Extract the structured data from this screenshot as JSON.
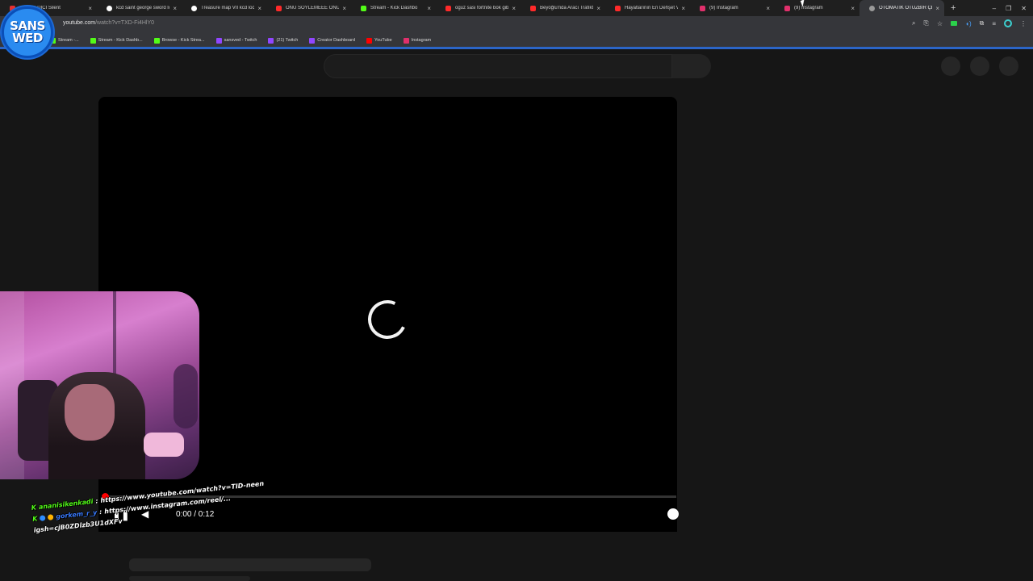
{
  "browser": {
    "tabs": [
      {
        "title": "ATSIZ EDİCİ Silent",
        "favicon_color": "#e63030",
        "active": false
      },
      {
        "title": "kcd saint george sword lo",
        "favicon_color": "#ffffff",
        "active": false
      },
      {
        "title": "Treasure map VII kcd locat",
        "favicon_color": "#ffffff",
        "active": false
      },
      {
        "title": "ONU SÖYLEMEEE ONU",
        "favicon_color": "#ff2a2a",
        "active": false
      },
      {
        "title": "Stream - Kick Dashbo",
        "favicon_color": "#53fc18",
        "active": false
      },
      {
        "title": "oguz sasi fortnite bok gib",
        "favicon_color": "#ff2a2a",
        "active": false
      },
      {
        "title": "Beyoğlu'nda Aracı Trafikte",
        "favicon_color": "#ff2a2a",
        "active": false
      },
      {
        "title": "Hayatlarının En Dehşet Ve",
        "favicon_color": "#ff2a2a",
        "active": false
      },
      {
        "title": "(9) Instagram",
        "favicon_color": "#e1306c",
        "active": false
      },
      {
        "title": "(9) Instagram",
        "favicon_color": "#e1306c",
        "active": false
      },
      {
        "title": "OTOMATİK OTUZBİR ÇEK",
        "favicon_color": "#9a9a9a",
        "active": true
      }
    ],
    "close_glyph": "×",
    "new_tab": "+",
    "window_controls": {
      "minimize": "–",
      "restore": "❐",
      "close": "✕"
    },
    "address": {
      "host": "youtube.com",
      "path": "/watch?v=TXD-Fi4HlY0"
    },
    "bookmarks": [
      {
        "label": "Stream -...",
        "icon_color": "#53fc18"
      },
      {
        "label": "Stream - Kick Dashb...",
        "icon_color": "#53fc18"
      },
      {
        "label": "Browse - Kick Strea...",
        "icon_color": "#53fc18"
      },
      {
        "label": "sansved - Twitch",
        "icon_color": "#9146ff"
      },
      {
        "label": "(21) Twitch",
        "icon_color": "#9146ff"
      },
      {
        "label": "Creator Dashboard",
        "icon_color": "#9146ff"
      },
      {
        "label": "YouTube",
        "icon_color": "#ff0000"
      },
      {
        "label": "Instagram",
        "icon_color": "#e1306c"
      }
    ]
  },
  "overlay": {
    "logo_line1": "SANS",
    "logo_line2": "WED"
  },
  "player": {
    "time": "0:00 / 0:12",
    "progress": 0.0
  },
  "chat": {
    "messages": [
      {
        "user": "ananisikenkadi",
        "sep": ":",
        "text": "https://www.youtube.com/watch?v=TID-neen"
      },
      {
        "user": "gorkem_r_y",
        "sep": ":",
        "text": "https://www.instagram.com/reel/..."
      },
      {
        "user": "",
        "sep": "",
        "text": "igsh=cjB0ZDlzb3U1dXFv"
      }
    ]
  },
  "colors": {
    "kick_green": "#53fc18",
    "youtube_red": "#ff0000",
    "accent_blue": "#2b65c7"
  }
}
